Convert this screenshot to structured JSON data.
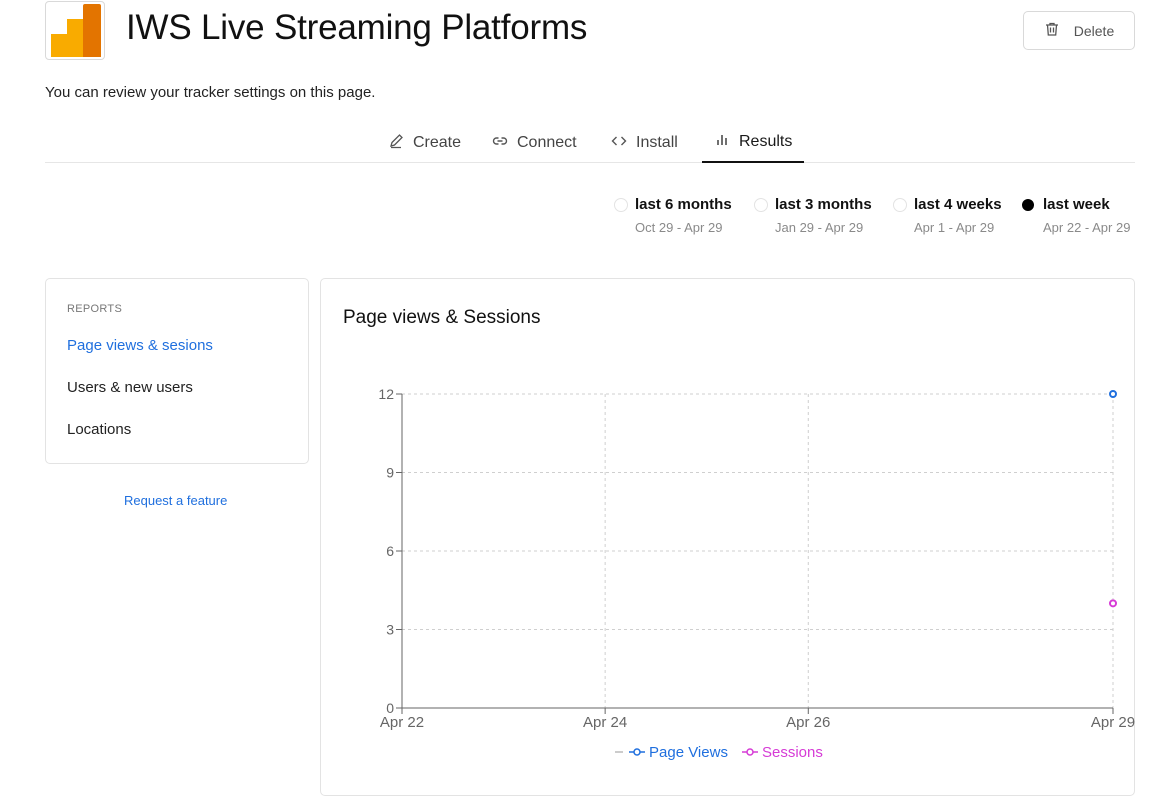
{
  "header": {
    "title": "IWS Live Streaming Platforms",
    "delete_label": "Delete",
    "subtitle": "You can review your tracker settings on this page."
  },
  "tabs": [
    {
      "label": "Create",
      "icon": "pencil-icon"
    },
    {
      "label": "Connect",
      "icon": "link-icon"
    },
    {
      "label": "Install",
      "icon": "code-icon"
    },
    {
      "label": "Results",
      "icon": "bar-chart-icon",
      "active": true
    }
  ],
  "ranges": [
    {
      "label": "last 6 months",
      "dates": "Oct 29 - Apr 29",
      "selected": false
    },
    {
      "label": "last 3 months",
      "dates": "Jan 29 - Apr 29",
      "selected": false
    },
    {
      "label": "last 4 weeks",
      "dates": "Apr 1 - Apr 29",
      "selected": false
    },
    {
      "label": "last week",
      "dates": "Apr 22 - Apr 29",
      "selected": true
    }
  ],
  "reports": {
    "heading": "REPORTS",
    "items": [
      {
        "label": "Page views & sesions",
        "active": true
      },
      {
        "label": "Users & new users",
        "active": false
      },
      {
        "label": "Locations",
        "active": false
      }
    ],
    "request_link": "Request a feature"
  },
  "chart_title": "Page views & Sessions",
  "chart_data": {
    "type": "line",
    "x_ticks": [
      "Apr 22",
      "Apr 24",
      "Apr 26",
      "Apr 29"
    ],
    "xlim": [
      "Apr 22",
      "Apr 29"
    ],
    "ylim": [
      0,
      12
    ],
    "y_ticks": [
      0,
      3,
      6,
      9,
      12
    ],
    "grid": true,
    "legend_position": "bottom",
    "series": [
      {
        "name": "Page Views",
        "color": "#1f6fde",
        "points": [
          {
            "x": "Apr 29",
            "y": 12
          }
        ]
      },
      {
        "name": "Sessions",
        "color": "#d63bd6",
        "points": [
          {
            "x": "Apr 29",
            "y": 4
          }
        ]
      }
    ]
  }
}
